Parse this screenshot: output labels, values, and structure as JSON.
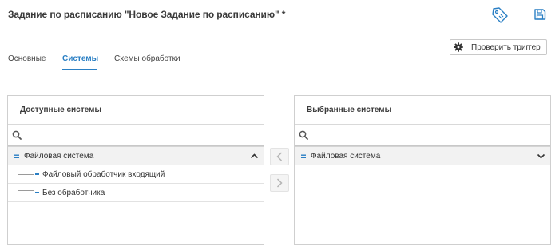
{
  "header": {
    "title": "Задание по расписанию \"Новое Задание по расписанию\" *",
    "tag_icon": "tag-icon",
    "save_icon": "save-icon"
  },
  "toolbar": {
    "check_trigger_label": "Проверить триггер",
    "check_trigger_icon": "gear-icon"
  },
  "tabs": [
    {
      "label": "Основные",
      "active": false
    },
    {
      "label": "Системы",
      "active": true
    },
    {
      "label": "Схемы обработки",
      "active": false
    }
  ],
  "available": {
    "title": "Доступные системы",
    "search_placeholder": "",
    "groups": [
      {
        "label": "Файловая система",
        "expanded": true,
        "children": [
          {
            "label": "Файловый обработчик входящий"
          },
          {
            "label": "Без обработчика"
          }
        ]
      }
    ]
  },
  "selected": {
    "title": "Выбранные системы",
    "search_placeholder": "",
    "groups": [
      {
        "label": "Файловая система",
        "expanded": false,
        "children": []
      }
    ]
  },
  "transfer": {
    "left_icon": "chevron-left-icon",
    "right_icon": "chevron-right-icon"
  },
  "colors": {
    "accent": "#2a7fc4",
    "border": "#cfcfcf",
    "group_bg": "#f2f2f2"
  }
}
